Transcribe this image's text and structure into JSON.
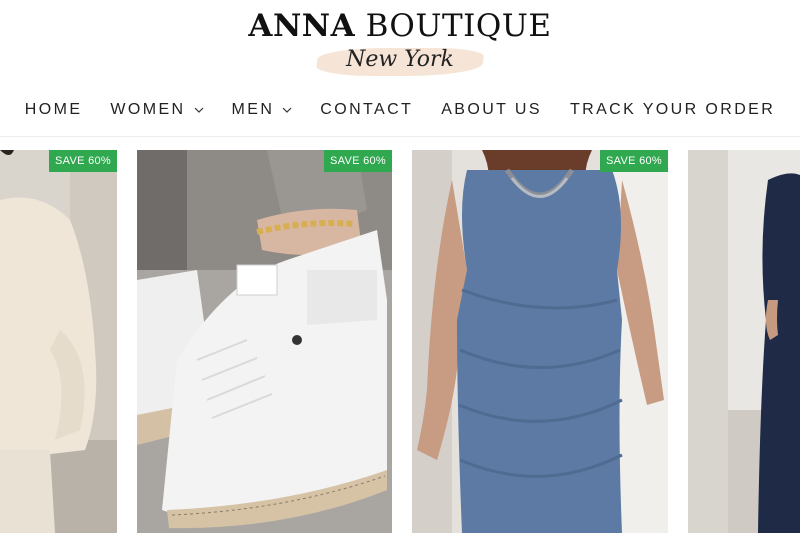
{
  "brand": {
    "name_bold": "ANNA",
    "name_rest": "BOUTIQUE",
    "tagline": "New York"
  },
  "nav": {
    "items": [
      {
        "label": "HOME",
        "has_dropdown": false
      },
      {
        "label": "WOMEN",
        "has_dropdown": true
      },
      {
        "label": "MEN",
        "has_dropdown": true
      },
      {
        "label": "CONTACT",
        "has_dropdown": false
      },
      {
        "label": "ABOUT US",
        "has_dropdown": false
      },
      {
        "label": "TRACK YOUR ORDER",
        "has_dropdown": false
      }
    ]
  },
  "products": [
    {
      "badge": "SAVE 60%"
    },
    {
      "badge": "SAVE 60%"
    },
    {
      "badge": "SAVE 60%"
    },
    {
      "badge": ""
    }
  ],
  "colors": {
    "badge_bg": "#2fa84f",
    "brush": "#f6e5d6",
    "dress": "#5c7aa3"
  }
}
